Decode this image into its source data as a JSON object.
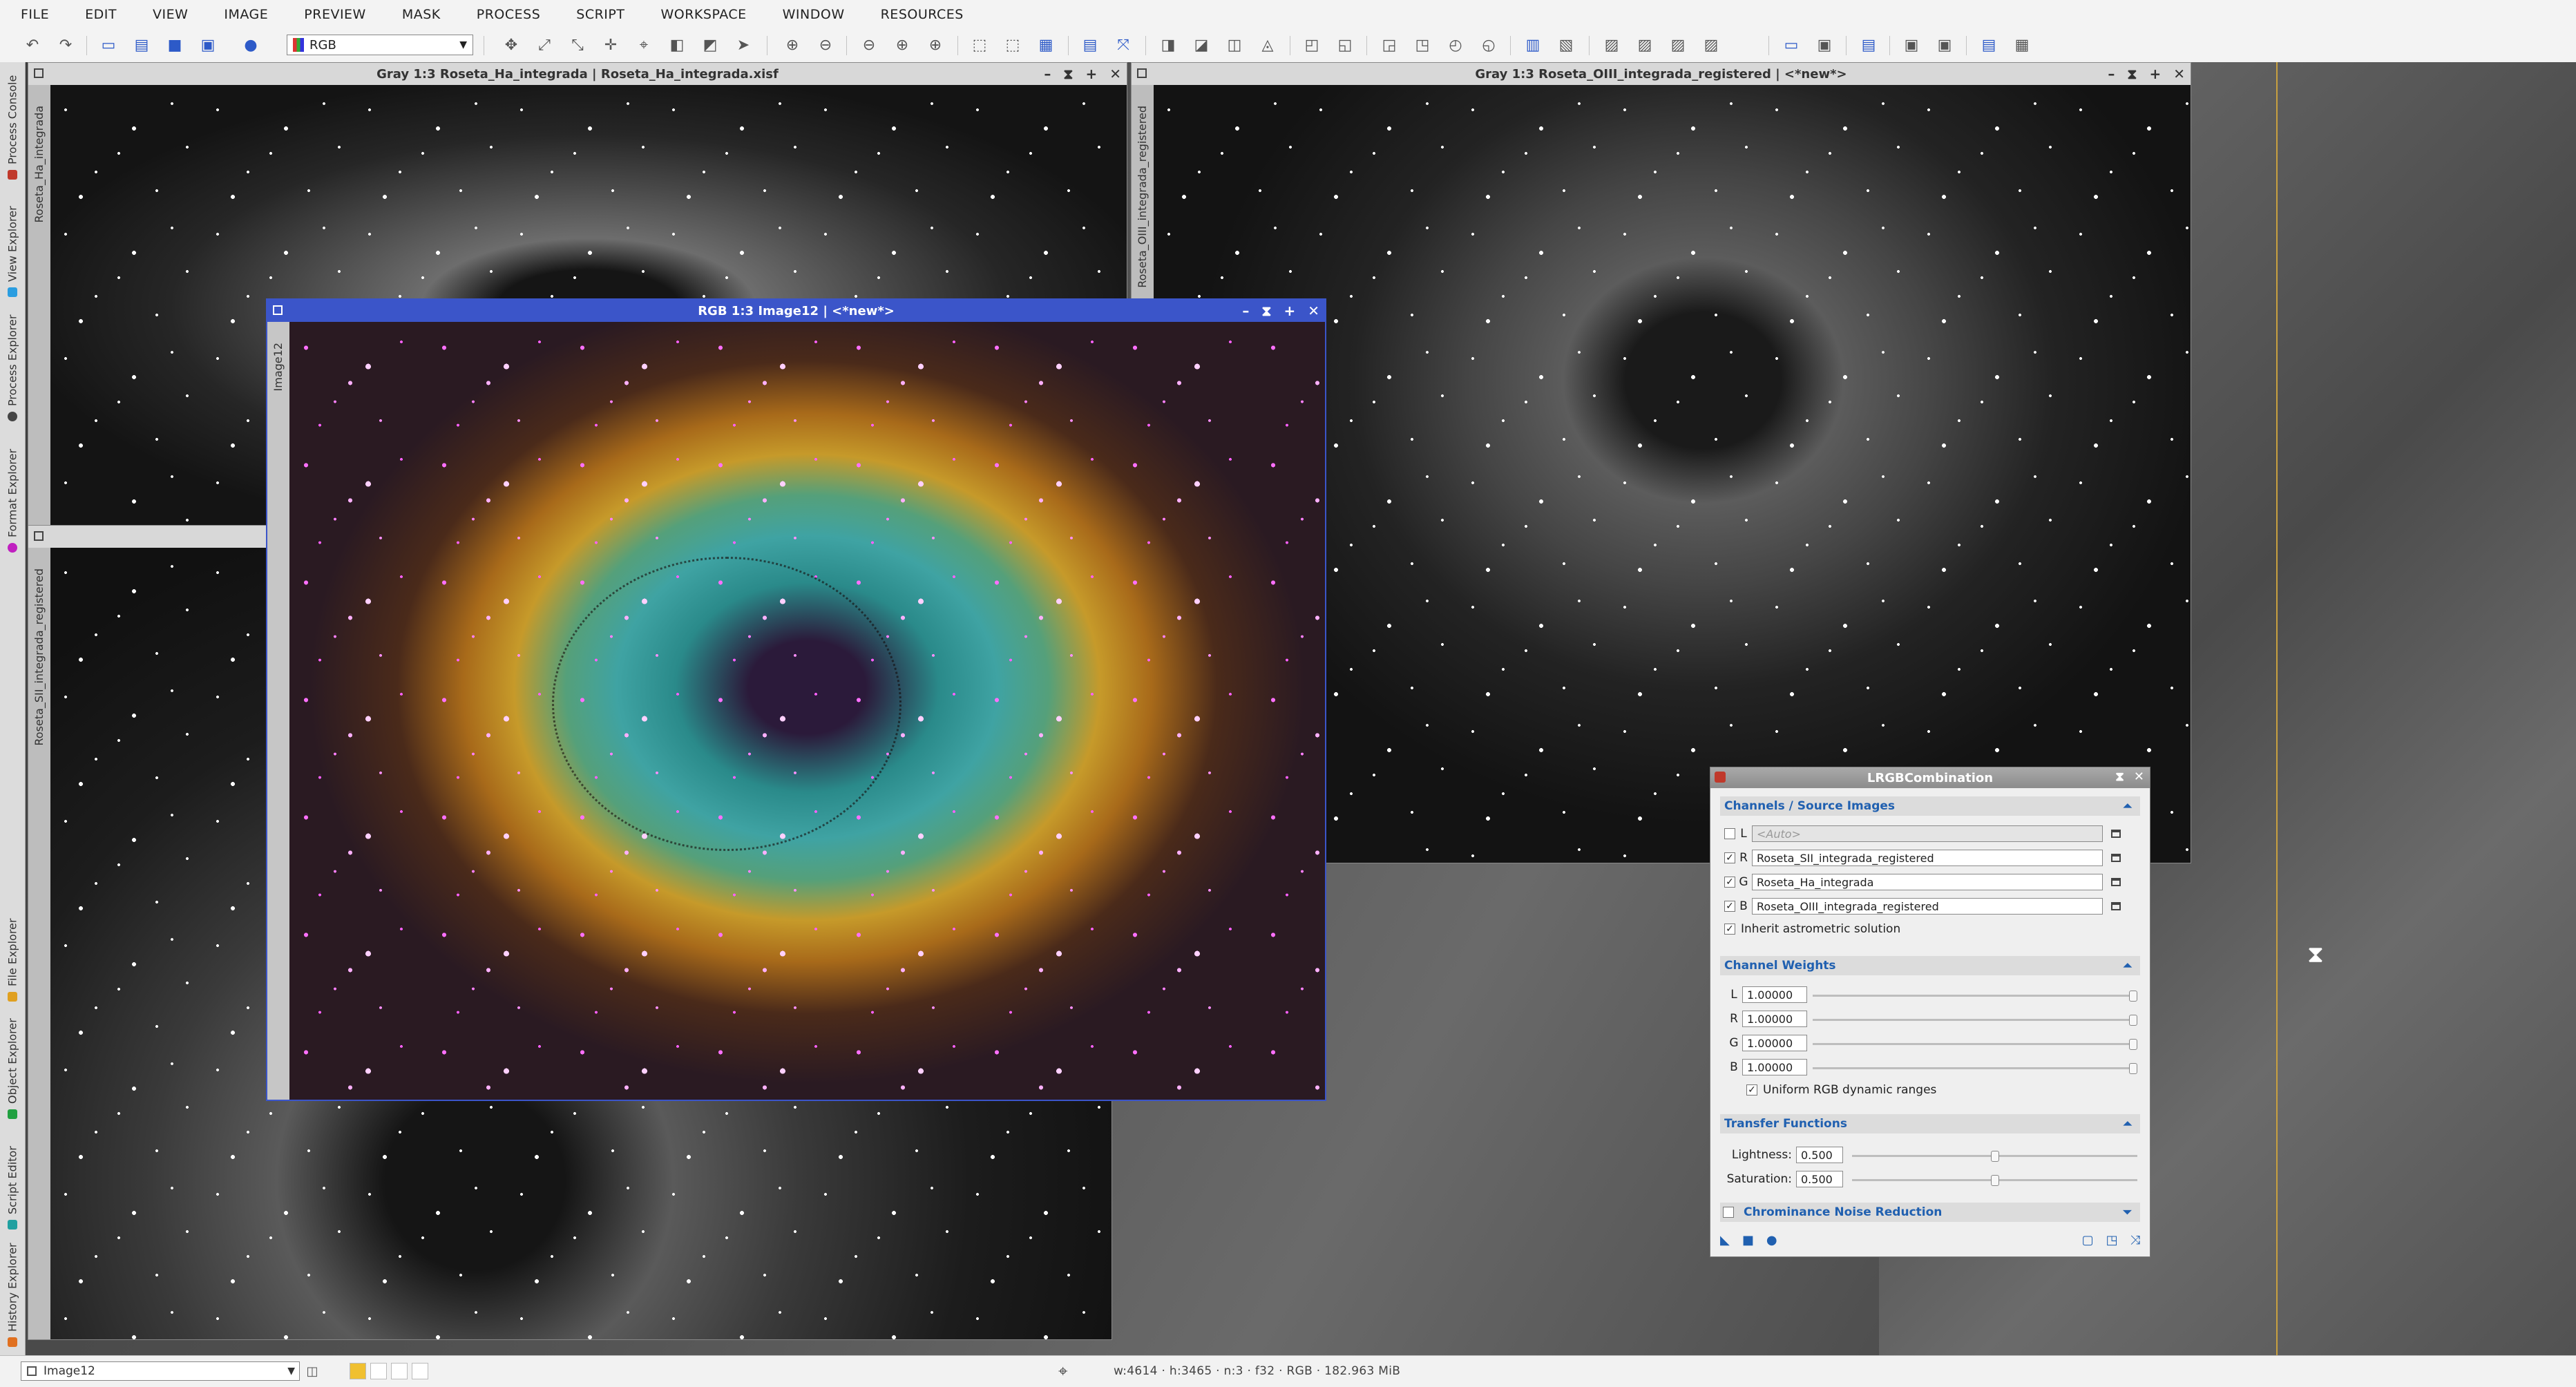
{
  "menu": [
    "FILE",
    "EDIT",
    "VIEW",
    "IMAGE",
    "PREVIEW",
    "MASK",
    "PROCESS",
    "SCRIPT",
    "WORKSPACE",
    "WINDOW",
    "RESOURCES"
  ],
  "toolbar": {
    "color_mode": "RGB"
  },
  "left_panel_tabs": [
    "Process Console",
    "View Explorer",
    "Process Explorer",
    "Format Explorer",
    "File Explorer",
    "Object Explorer",
    "Script Editor",
    "History Explorer"
  ],
  "windows": {
    "ha": {
      "title": "Gray 1:3 Roseta_Ha_integrada | Roseta_Ha_integrada.xisf",
      "side_label": "Roseta_Ha_integrada"
    },
    "oiii": {
      "title": "Gray 1:3 Roseta_OIII_integrada_registered | <*new*>",
      "side_label": "Roseta_OIII_integrada_registered"
    },
    "sii": {
      "side_label": "Roseta_SII_integrada_registered"
    },
    "rgb": {
      "title": "RGB 1:3 Image12 | <*new*>",
      "side_label": "Image12"
    }
  },
  "dialog": {
    "title": "LRGBCombination",
    "sections": {
      "channels": "Channels / Source Images",
      "weights": "Channel Weights",
      "transfer": "Transfer Functions",
      "chrominance": "Chrominance Noise Reduction"
    },
    "channels": [
      {
        "label": "L",
        "checked": false,
        "value": "<Auto>",
        "disabled": true
      },
      {
        "label": "R",
        "checked": true,
        "value": "Roseta_SII_integrada_registered",
        "disabled": false
      },
      {
        "label": "G",
        "checked": true,
        "value": "Roseta_Ha_integrada",
        "disabled": false
      },
      {
        "label": "B",
        "checked": true,
        "value": "Roseta_OIII_integrada_registered",
        "disabled": false
      }
    ],
    "inherit_astrometric": {
      "label": "Inherit astrometric solution",
      "checked": true
    },
    "weights": [
      {
        "label": "L",
        "value": "1.00000",
        "fraction": 1.0
      },
      {
        "label": "R",
        "value": "1.00000",
        "fraction": 1.0
      },
      {
        "label": "G",
        "value": "1.00000",
        "fraction": 1.0
      },
      {
        "label": "B",
        "value": "1.00000",
        "fraction": 1.0
      }
    ],
    "uniform_rgb": {
      "label": "Uniform RGB dynamic ranges",
      "checked": true
    },
    "transfer": [
      {
        "label": "Lightness:",
        "value": "0.500",
        "fraction": 0.5
      },
      {
        "label": "Saturation:",
        "value": "0.500",
        "fraction": 0.5
      }
    ],
    "chrominance_checked": false
  },
  "statusbar": {
    "view": "Image12",
    "info": "w:4614 · h:3465 · n:3 · f32 · RGB · 182.963 MiB"
  }
}
